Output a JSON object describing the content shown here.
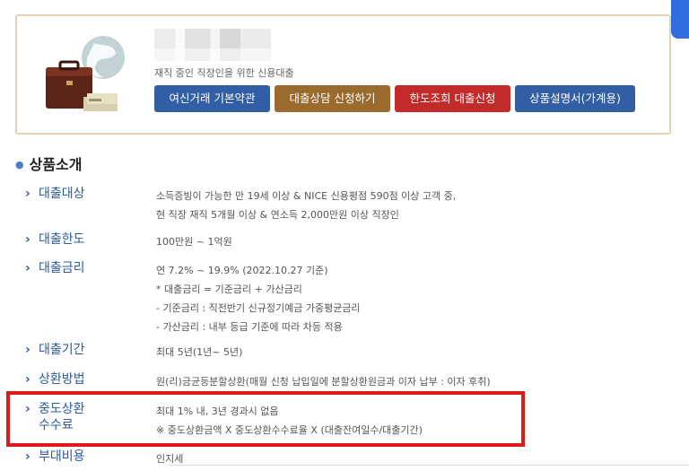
{
  "product": {
    "subtitle": "재직 중인 직장인을 위한 신용대출",
    "buttons": {
      "terms": "여신거래 기본약관",
      "consult": "대출상담 신청하기",
      "apply": "한도조회 대출신청",
      "description": "상품설명서(가계용)"
    },
    "colors": {
      "border": "#e3d3b4",
      "primary": "#315ea5",
      "brown": "#9b6b2e",
      "red": "#c32b2b"
    }
  },
  "section": {
    "title": "상품소개"
  },
  "rows": [
    {
      "label": "대출대상",
      "lines": [
        "소득증빙이 가능한 만 19세 이상 & NICE 신용평점 590점 이상 고객 중,",
        "현 직장 재직 5개월 이상 & 연소득 2,000만원 이상 직장인"
      ]
    },
    {
      "label": "대출한도",
      "lines": [
        "100만원 ~ 1억원"
      ]
    },
    {
      "label": "대출금리",
      "lines": [
        "연 7.2% ~ 19.9% (2022.10.27 기준)",
        "* 대출금리 = 기준금리 + 가산금리",
        "- 기준금리 : 직전반기 신규정기예금 가중평균금리",
        "- 가산금리 : 내부 등급 기준에 따라 차등 적용"
      ]
    },
    {
      "label": "대출기간",
      "lines": [
        "최대 5년(1년~ 5년)"
      ]
    },
    {
      "label": "상환방법",
      "lines": [
        "원(리)금균등분할상환(매월 신청 납입일에 분할상환원금과 이자 납부 : 이자 후취)"
      ]
    },
    {
      "label_lines": [
        "중도상환",
        "수수료"
      ],
      "lines": [
        "최대 1% 내, 3년 경과시 없음",
        "※ 중도상환금액 X 중도상환수수료율 X (대출잔여일수/대출기간)"
      ]
    },
    {
      "label": "부대비용",
      "lines": [
        "인지세"
      ]
    }
  ],
  "icons": {
    "bullet": "bullet-dot-icon",
    "arrow": "chevron-right-icon",
    "product": "briefcase-money-icon"
  },
  "highlight_color": "#e01a1a"
}
